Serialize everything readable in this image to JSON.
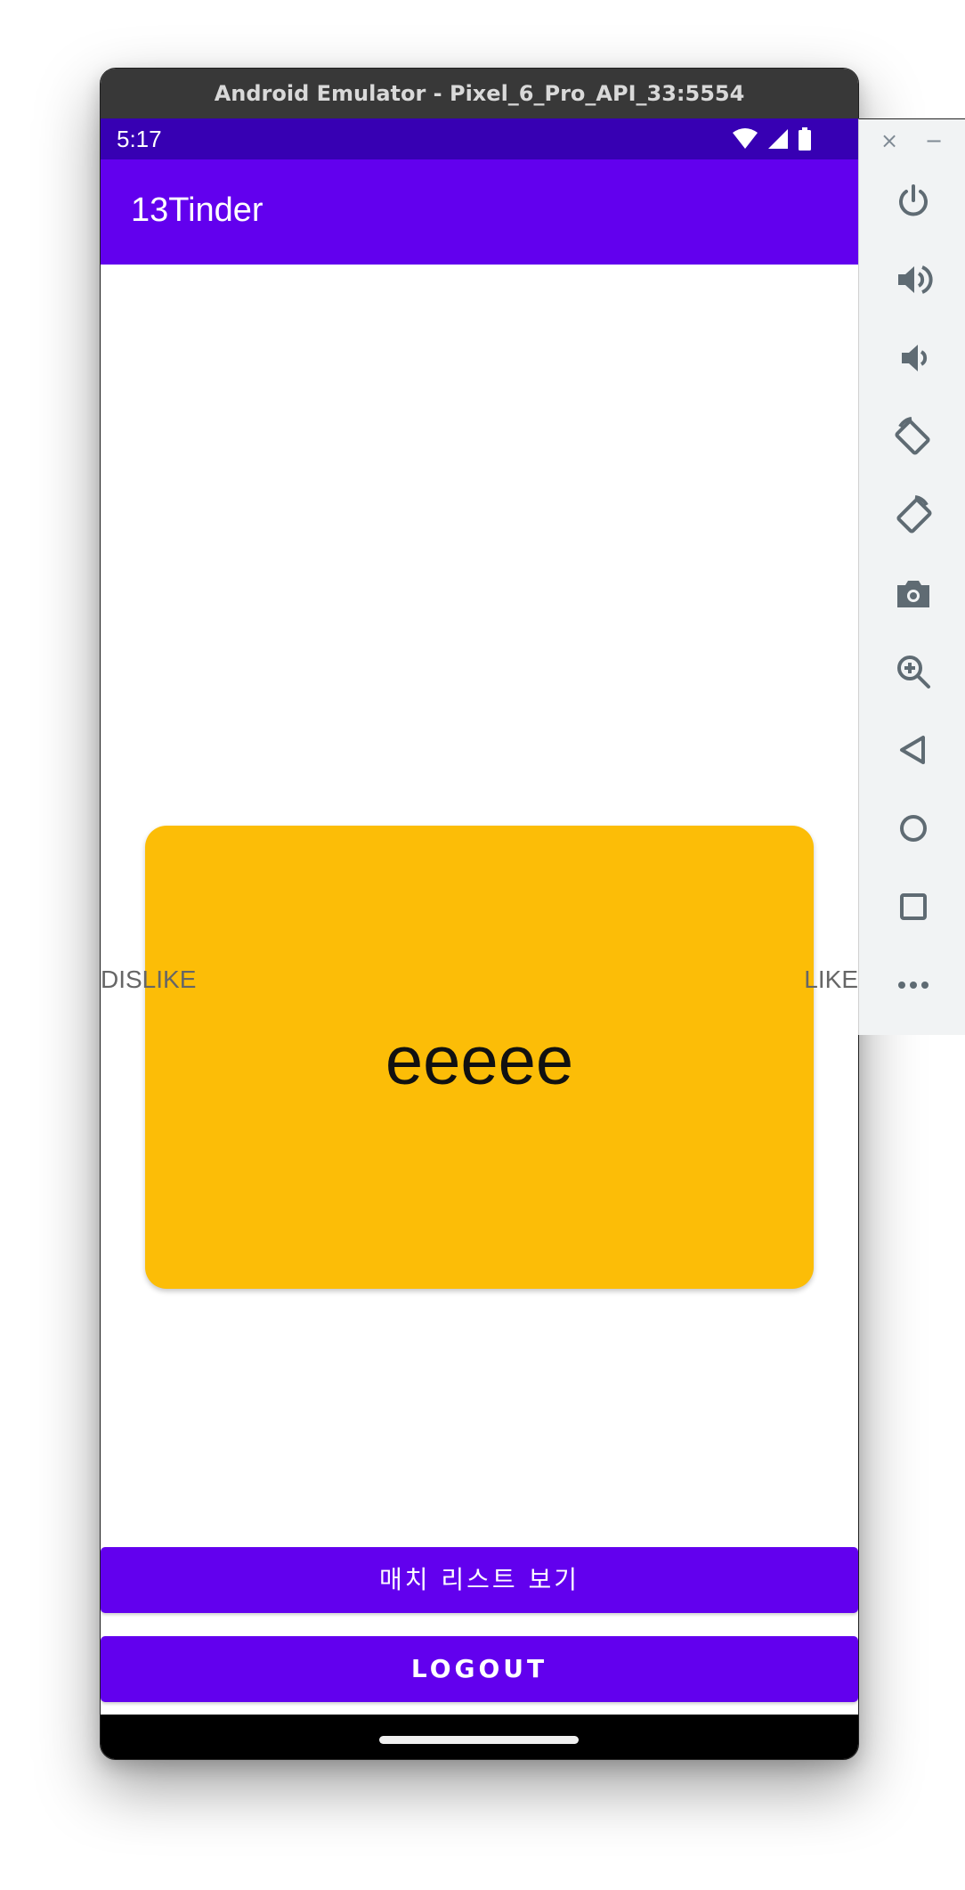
{
  "window": {
    "title": "Android Emulator - Pixel_6_Pro_API_33:5554"
  },
  "status_bar": {
    "time": "5:17",
    "icons": [
      "wifi-icon",
      "signal-icon",
      "battery-icon"
    ]
  },
  "app_bar": {
    "title": "13Tinder"
  },
  "card": {
    "text": "eeeee",
    "color": "#fcbd07"
  },
  "swipe_labels": {
    "left": "DISLIKE",
    "right": "LIKE"
  },
  "buttons": {
    "match_list": "매치 리스트 보기",
    "logout": "LOGOUT"
  },
  "emulator_tools": {
    "close": "×",
    "minimize": "−",
    "items": [
      "power-icon",
      "volume-up-icon",
      "volume-down-icon",
      "rotate-left-icon",
      "rotate-right-icon",
      "camera-icon",
      "zoom-icon",
      "back-icon",
      "home-icon",
      "overview-icon",
      "more-icon"
    ]
  },
  "colors": {
    "primary": "#6200ee",
    "primary_dark": "#3700b3",
    "accent_card": "#fcbd07"
  }
}
